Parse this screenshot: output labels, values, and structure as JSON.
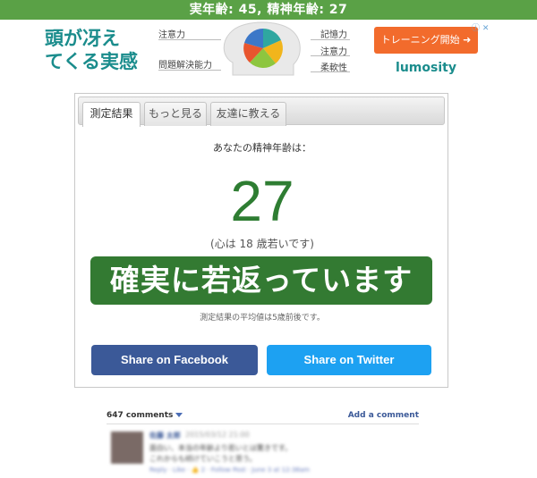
{
  "header": {
    "title": "実年齢: 45, 精神年齢: 27"
  },
  "ad": {
    "headline_line1": "頭が冴え",
    "headline_line2": "てくる実感",
    "skill_labels": [
      "注意力",
      "問題解決能力",
      "記憶力",
      "注意力",
      "柔軟性"
    ],
    "cta_label": "トレーニング開始 ➜",
    "brand": "lumosity",
    "info_icon": "ⓘ",
    "close_icon": "✕",
    "pie_colors": [
      "#2fa7a0",
      "#f1b51c",
      "#8dc63f",
      "#e8552e",
      "#3c78c8"
    ]
  },
  "tabs": [
    {
      "label": "測定結果",
      "active": true
    },
    {
      "label": "もっと見る",
      "active": false
    },
    {
      "label": "友達に教える",
      "active": false
    }
  ],
  "result": {
    "label": "あなたの精神年齢は：",
    "mental_age": "27",
    "younger_note": "(心は 18 歳若いです)",
    "verdict": "確実に若返っています",
    "average_note": "測定結果の平均値は5歳前後です。",
    "accent_color": "#2e7d32"
  },
  "share": {
    "facebook_label": "Share on Facebook",
    "twitter_label": "Share on Twitter",
    "facebook_color": "#3b5998",
    "twitter_color": "#1da1f2"
  },
  "comments": {
    "count_label": "647 comments",
    "add_label": "Add a comment",
    "items": [
      {
        "name": "佐藤 太郎",
        "meta": "2015/03/12 21:00",
        "text_line1": "面白い、本当の年齢より若いとは驚きです。",
        "text_line2": "これからも続けていこうと思う。",
        "actions": "Reply · Like · 👍 2 · Follow Post · June 3 at 12:38am"
      }
    ]
  }
}
